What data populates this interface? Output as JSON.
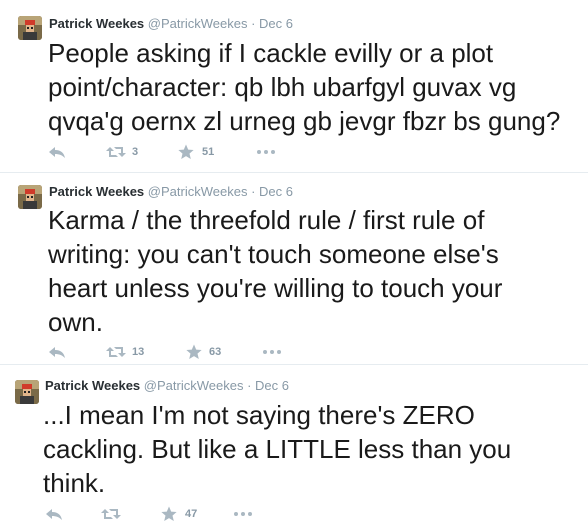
{
  "tweets": [
    {
      "name": "Patrick Weekes",
      "handle": "@PatrickWeekes",
      "separator": "·",
      "date": "Dec 6",
      "lines": [
        "People asking if I cackle evilly or a plot",
        "point/character: qb lbh ubarfgyl guvax vg",
        "qvqa'g oernx zl urneg gb jevgr fbzr bs gung?"
      ],
      "retweets": "3",
      "favorites": "51"
    },
    {
      "name": "Patrick Weekes",
      "handle": "@PatrickWeekes",
      "separator": "·",
      "date": "Dec 6",
      "lines": [
        "Karma / the threefold rule / first rule of",
        "writing: you can't touch someone else's",
        "heart unless you're willing to touch your",
        "own."
      ],
      "retweets": "13",
      "favorites": "63"
    },
    {
      "name": "Patrick Weekes",
      "handle": "@PatrickWeekes",
      "separator": "·",
      "date": "Dec 6",
      "lines": [
        "...I mean I'm not saying there's ZERO",
        "cackling. But like a LITTLE less than you",
        "think."
      ],
      "retweets": "",
      "favorites": "47"
    }
  ],
  "icons": {
    "reply": "reply-icon",
    "retweet": "retweet-icon",
    "favorite": "star-icon",
    "more": "more-icon"
  },
  "colors": {
    "name": "#292f33",
    "meta": "#8899a6",
    "icon": "#aab8c2"
  }
}
